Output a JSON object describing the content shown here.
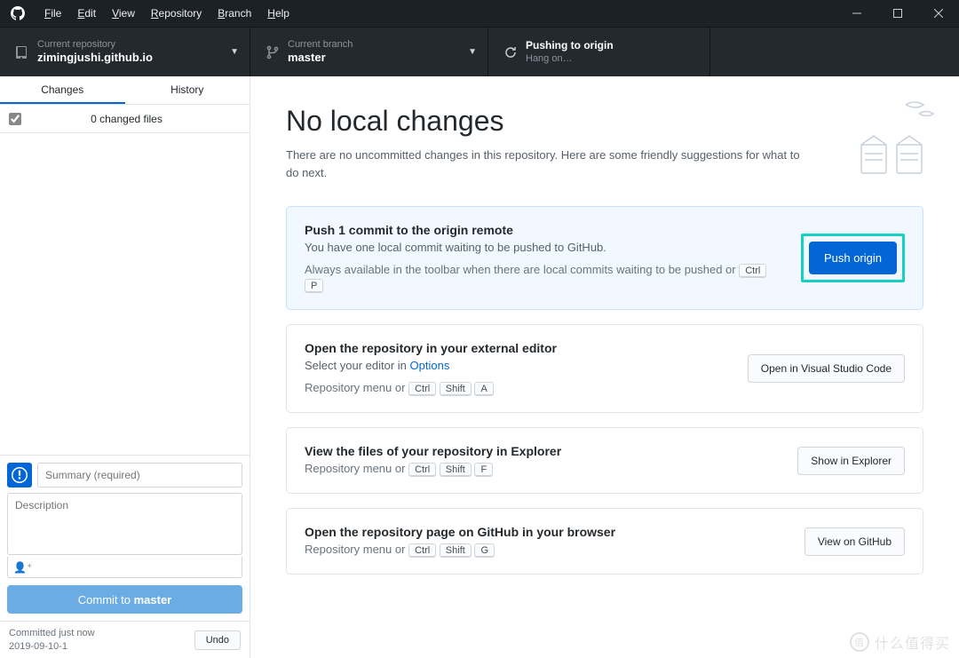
{
  "menubar": {
    "items": [
      "File",
      "Edit",
      "View",
      "Repository",
      "Branch",
      "Help"
    ]
  },
  "toolbar": {
    "repo": {
      "label": "Current repository",
      "value": "zimingjushi.github.io"
    },
    "branch": {
      "label": "Current branch",
      "value": "master"
    },
    "push": {
      "label": "Pushing to origin",
      "value": "Hang on…"
    }
  },
  "sidebar": {
    "tabs": {
      "changes": "Changes",
      "history": "History"
    },
    "changed_files": "0 changed files",
    "summary_placeholder": "Summary (required)",
    "description_placeholder": "Description",
    "commit_prefix": "Commit to ",
    "commit_branch": "master",
    "footer_line1": "Committed just now",
    "footer_line2": "2019-09-10-1",
    "undo": "Undo"
  },
  "main": {
    "title": "No local changes",
    "subtitle": "There are no uncommitted changes in this repository. Here are some friendly suggestions for what to do next.",
    "cards": [
      {
        "title": "Push 1 commit to the origin remote",
        "subtitle": "You have one local commit waiting to be pushed to GitHub.",
        "hint_prefix": "Always available in the toolbar when there are local commits waiting to be pushed or ",
        "keys": [
          "Ctrl",
          "P"
        ],
        "action": "Push origin",
        "style": "blue",
        "highlight": true
      },
      {
        "title": "Open the repository in your external editor",
        "subtitle_prefix": "Select your editor in ",
        "subtitle_link": "Options",
        "hint_prefix": "Repository menu or ",
        "keys": [
          "Ctrl",
          "Shift",
          "A"
        ],
        "action": "Open in Visual Studio Code"
      },
      {
        "title": "View the files of your repository in Explorer",
        "hint_prefix": "Repository menu or ",
        "keys": [
          "Ctrl",
          "Shift",
          "F"
        ],
        "action": "Show in Explorer"
      },
      {
        "title": "Open the repository page on GitHub in your browser",
        "hint_prefix": "Repository menu or ",
        "keys": [
          "Ctrl",
          "Shift",
          "G"
        ],
        "action": "View on GitHub"
      }
    ]
  },
  "watermark": "什么值得买"
}
